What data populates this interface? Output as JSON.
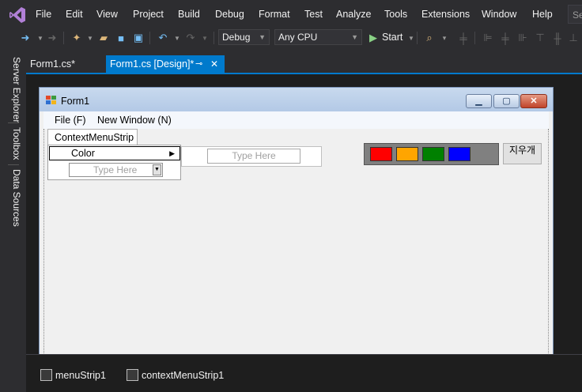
{
  "menubar": {
    "items": [
      "File",
      "Edit",
      "View",
      "Project",
      "Build",
      "Debug",
      "Format",
      "Test",
      "Analyze",
      "Tools",
      "Extensions",
      "Window",
      "Help"
    ],
    "search_text": "Se"
  },
  "toolbar": {
    "config_combo": "Debug",
    "platform_combo": "Any CPU",
    "start_label": "Start"
  },
  "side_tabs": [
    "Server Explorer",
    "Toolbox",
    "Data Sources"
  ],
  "doc_tabs": {
    "tab1": "Form1.cs*",
    "tab2": "Form1.cs [Design]*",
    "pin_glyph": "⊸",
    "close_glyph": "✕"
  },
  "form": {
    "title": "Form1",
    "menu_items": [
      "File (F)",
      "New Window (N)"
    ],
    "context_menu_tab": "ContextMenuStrip",
    "color_item": "Color",
    "type_here": "Type Here",
    "submenu_type_here": "Type Here",
    "clear_button": "지우개",
    "swatch_colors": [
      "#ff0000",
      "#ffa500",
      "#008000",
      "#0000ff"
    ]
  },
  "tray": {
    "items": [
      "menuStrip1",
      "contextMenuStrip1"
    ]
  },
  "colors": {
    "accent": "#007acc",
    "background": "#2d2d30"
  }
}
